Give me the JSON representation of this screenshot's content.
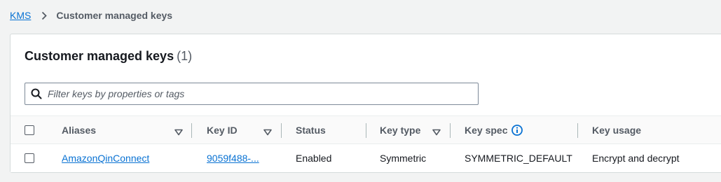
{
  "breadcrumb": {
    "root": "KMS",
    "current": "Customer managed keys"
  },
  "panel": {
    "title": "Customer managed keys",
    "count": "(1)"
  },
  "search": {
    "placeholder": "Filter keys by properties or tags",
    "value": ""
  },
  "table": {
    "columns": {
      "aliases": "Aliases",
      "key_id": "Key ID",
      "status": "Status",
      "key_type": "Key type",
      "key_spec": "Key spec",
      "key_usage": "Key usage"
    },
    "rows": [
      {
        "alias": "AmazonQinConnect",
        "key_id": "9059f488-...",
        "status": "Enabled",
        "key_type": "Symmetric",
        "key_spec": "SYMMETRIC_DEFAULT",
        "key_usage": "Encrypt and decrypt"
      }
    ]
  },
  "colors": {
    "link": "#0972d3",
    "text": "#16191f",
    "muted": "#545b64",
    "background": "#f2f3f3"
  },
  "icons": {
    "breadcrumb_separator": "chevron-right-icon",
    "search": "search-icon",
    "sort": "caret-down-icon",
    "info": "info-icon"
  }
}
